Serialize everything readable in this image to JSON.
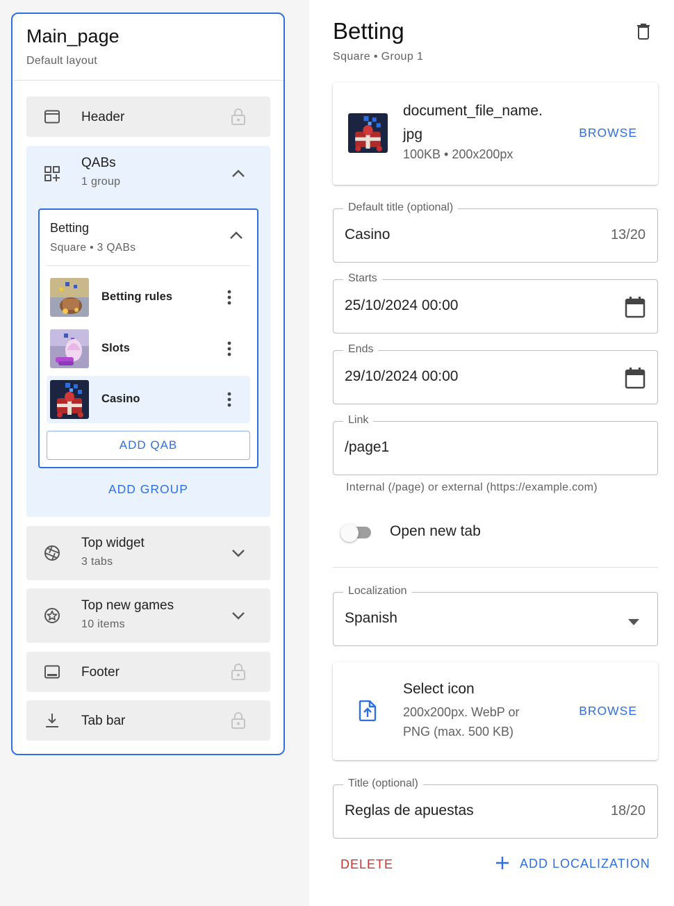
{
  "page": {
    "title": "Main_page",
    "subtitle": "Default layout"
  },
  "sections": [
    {
      "label": "Header",
      "icon": "web-asset-icon",
      "trail": "lock-icon"
    },
    {
      "label": "QABs",
      "sub": "1 group",
      "icon": "qab-grid-icon",
      "trail": "chevron-up-icon"
    },
    {
      "label": "Top widget",
      "sub": "3 tabs",
      "icon": "aperture-icon",
      "trail": "chevron-down-icon"
    },
    {
      "label": "Top new games",
      "sub": "10 items",
      "icon": "star-circle-icon",
      "trail": "chevron-down-icon"
    },
    {
      "label": "Footer",
      "icon": "footer-icon",
      "trail": "lock-icon"
    },
    {
      "label": "Tab bar",
      "icon": "download-icon",
      "trail": "lock-icon"
    }
  ],
  "qab_group": {
    "title": "Betting",
    "subtitle": "Square • 3 QABs",
    "items": [
      {
        "label": "Betting rules"
      },
      {
        "label": "Slots"
      },
      {
        "label": "Casino",
        "selected": true
      }
    ],
    "add_qab_label": "ADD QAB",
    "add_group_label": "ADD GROUP"
  },
  "detail": {
    "title": "Betting",
    "subtitle": "Square • Group 1",
    "file": {
      "name_line1": "document_file_name.",
      "name_line2": "jpg",
      "meta": "100KB • 200x200px",
      "browse_label": "BROWSE"
    },
    "default_title": {
      "label": "Default title (optional)",
      "value": "Casino",
      "count": "13/20"
    },
    "starts": {
      "label": "Starts",
      "value": "25/10/2024 00:00"
    },
    "ends": {
      "label": "Ends",
      "value": "29/10/2024 00:00"
    },
    "link": {
      "label": "Link",
      "value": "/page1",
      "helper": "Internal (/page) or external (https://example.com)"
    },
    "open_new_tab": {
      "label": "Open new tab",
      "on": false
    },
    "localization": {
      "label": "Localization",
      "value": "Spanish"
    },
    "icon_upload": {
      "title": "Select icon",
      "desc_line1": "200x200px. WebP or",
      "desc_line2": "PNG (max. 500 KB)",
      "browse_label": "BROWSE"
    },
    "loc_title": {
      "label": "Title (optional)",
      "value": "Reglas de apuestas",
      "count": "18/20"
    },
    "delete_label": "DELETE",
    "add_localization_label": "ADD LOCALIZATION"
  },
  "colors": {
    "accent": "#2f6fe0",
    "danger": "#d32f2f",
    "panel_bg": "#f5f5f5",
    "section_bg": "#eeeeee",
    "selected_bg": "#eaf2fd"
  }
}
